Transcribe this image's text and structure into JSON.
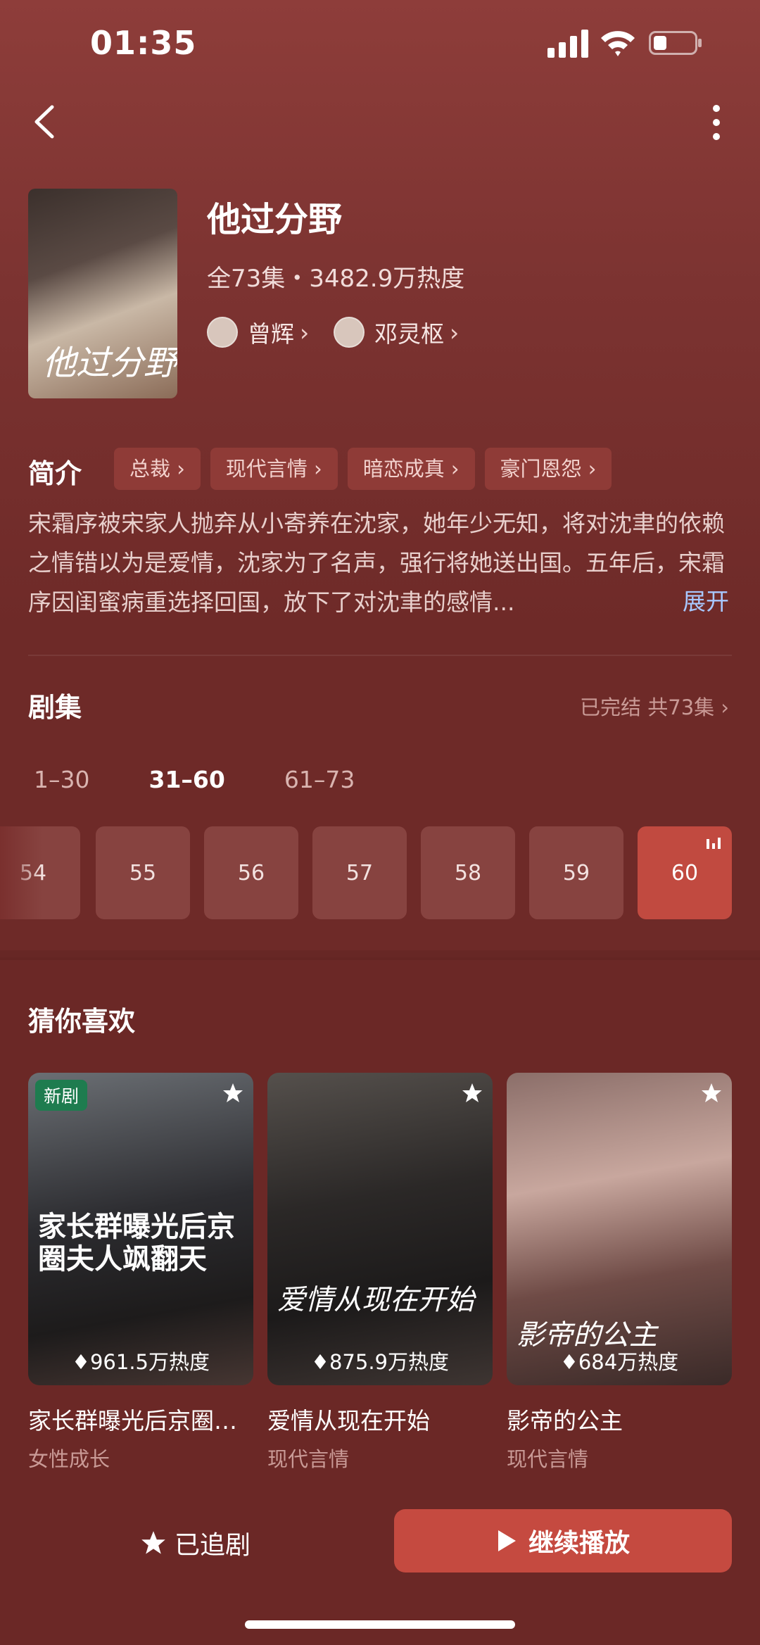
{
  "status_bar": {
    "time": "01:35"
  },
  "drama": {
    "title": "他过分野",
    "meta": "全73集・3482.9万热度",
    "poster_text": "他过分野",
    "actors": [
      {
        "name": "曾辉"
      },
      {
        "name": "邓灵枢"
      }
    ]
  },
  "intro": {
    "label": "简介",
    "tags": [
      "总裁",
      "现代言情",
      "暗恋成真",
      "豪门恩怨"
    ],
    "synopsis": "宋霜序被宋家人抛弃从小寄养在沈家，她年少无知，将对沈聿的依赖之情错以为是爱情，沈家为了名声，强行将她送出国。五年后，宋霜序因闺蜜病重选择回国，放下了对沈聿的感情...",
    "expand_label": "展开"
  },
  "episodes": {
    "title": "剧集",
    "status": "已完结 共73集",
    "ranges": [
      "1–30",
      "31–60",
      "61–73"
    ],
    "active_range": "31–60",
    "items": [
      "54",
      "55",
      "56",
      "57",
      "58",
      "59",
      "60"
    ],
    "current": "60"
  },
  "recommend": {
    "title": "猜你喜欢",
    "cards": [
      {
        "name": "家长群曝光后京圈…",
        "genre": "女性成长",
        "heat": "961.5万热度",
        "badge": "新剧",
        "overlay": "家长群曝光后京圈夫人飒翻天"
      },
      {
        "name": "爱情从现在开始",
        "genre": "现代言情",
        "heat": "875.9万热度",
        "overlay": "爱情从现在开始"
      },
      {
        "name": "影帝的公主",
        "genre": "现代言情",
        "heat": "684万热度",
        "overlay": "影帝的公主"
      }
    ]
  },
  "bottom_bar": {
    "follow_label": "已追剧",
    "play_label": "继续播放"
  },
  "colors": {
    "background": "#6e2a28",
    "accent": "#c54a40",
    "tag_bg": "#8f3b37",
    "expand_link": "#a8c8ff"
  }
}
